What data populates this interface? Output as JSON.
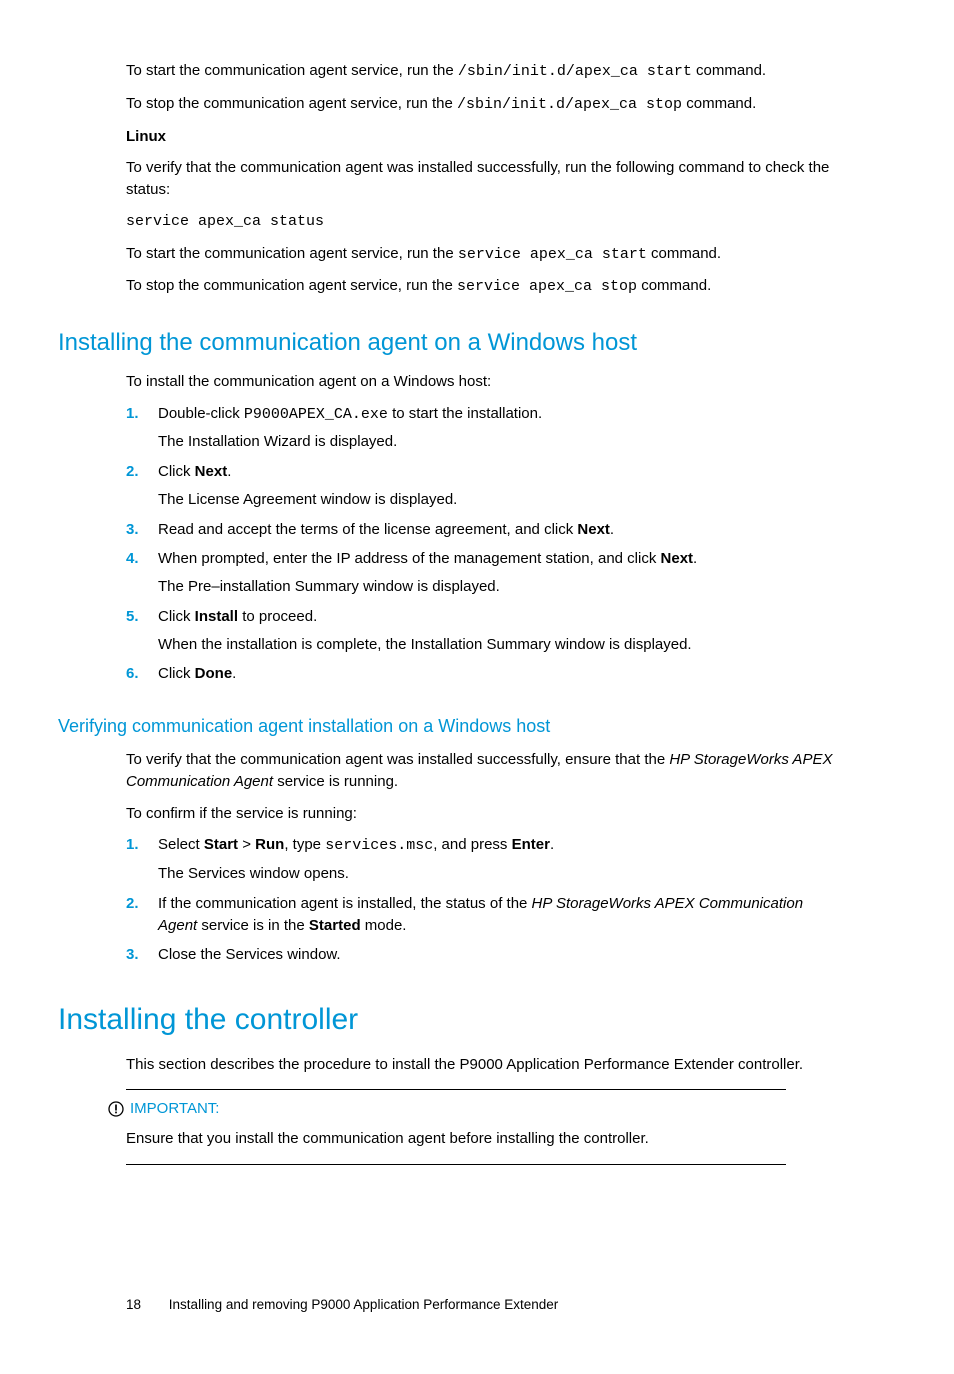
{
  "intro": {
    "start_pre": "To start the communication agent service, run the ",
    "start_cmd": "/sbin/init.d/apex_ca start",
    "start_post": " command.",
    "stop_pre": "To stop the communication agent service, run the ",
    "stop_cmd": "/sbin/init.d/apex_ca stop",
    "stop_post": " command.",
    "linux_heading": "Linux",
    "linux_verify": "To verify that the communication agent was installed successfully, run the following command to check the status:",
    "linux_status_cmd": "service apex_ca status",
    "linux_start_pre": "To start the communication agent service, run the ",
    "linux_start_cmd": "service apex_ca start",
    "linux_start_post": " command.",
    "linux_stop_pre": "To stop the communication agent service, run the ",
    "linux_stop_cmd": "service apex_ca stop",
    "linux_stop_post": " command."
  },
  "sec1": {
    "heading": "Installing the communication agent on a Windows host",
    "intro": "To install the communication agent on a Windows host:",
    "steps": [
      {
        "num": "1.",
        "line1_pre": "Double-click ",
        "line1_code": "P9000APEX_CA.exe",
        "line1_post": " to start the installation.",
        "line2": "The Installation Wizard is displayed."
      },
      {
        "num": "2.",
        "line1_pre": "Click ",
        "line1_bold": "Next",
        "line1_post": ".",
        "line2": "The License Agreement window is displayed."
      },
      {
        "num": "3.",
        "line1_pre": "Read and accept the terms of the license agreement, and click ",
        "line1_bold": "Next",
        "line1_post": "."
      },
      {
        "num": "4.",
        "line1_pre": "When prompted, enter the IP address of the management station, and click ",
        "line1_bold": "Next",
        "line1_post": ".",
        "line2": "The Pre–installation Summary window is displayed."
      },
      {
        "num": "5.",
        "line1_pre": "Click ",
        "line1_bold": "Install",
        "line1_post": " to proceed.",
        "line2": "When the installation is complete, the Installation Summary window is displayed."
      },
      {
        "num": "6.",
        "line1_pre": "Click ",
        "line1_bold": "Done",
        "line1_post": "."
      }
    ]
  },
  "sec2": {
    "heading": "Verifying communication agent installation on a Windows host",
    "intro_pre": "To verify that the communication agent was installed successfully, ensure that the ",
    "intro_italic": "HP StorageWorks APEX Communication Agent",
    "intro_post": " service is running.",
    "confirm": "To confirm if the service is running:",
    "s1_num": "1.",
    "s1_pre": "Select ",
    "s1_b1": "Start",
    "s1_gt": " > ",
    "s1_b2": "Run",
    "s1_mid": ", type ",
    "s1_code": "services.msc",
    "s1_mid2": ", and press ",
    "s1_b3": "Enter",
    "s1_post": ".",
    "s1_line2": "The Services window opens.",
    "s2_num": "2.",
    "s2_pre": "If the communication agent is installed, the status of the ",
    "s2_italic": "HP StorageWorks APEX Communication Agent",
    "s2_mid": " service is in the ",
    "s2_bold": "Started",
    "s2_post": " mode.",
    "s3_num": "3.",
    "s3_text": "Close the Services window."
  },
  "sec3": {
    "heading": "Installing the controller",
    "intro": "This section describes the procedure to install the P9000 Application Performance Extender controller.",
    "callout_label": "IMPORTANT:",
    "callout_body": "Ensure that you install the communication agent before installing the controller."
  },
  "footer": {
    "page": "18",
    "title": "Installing and removing P9000 Application Performance Extender"
  }
}
